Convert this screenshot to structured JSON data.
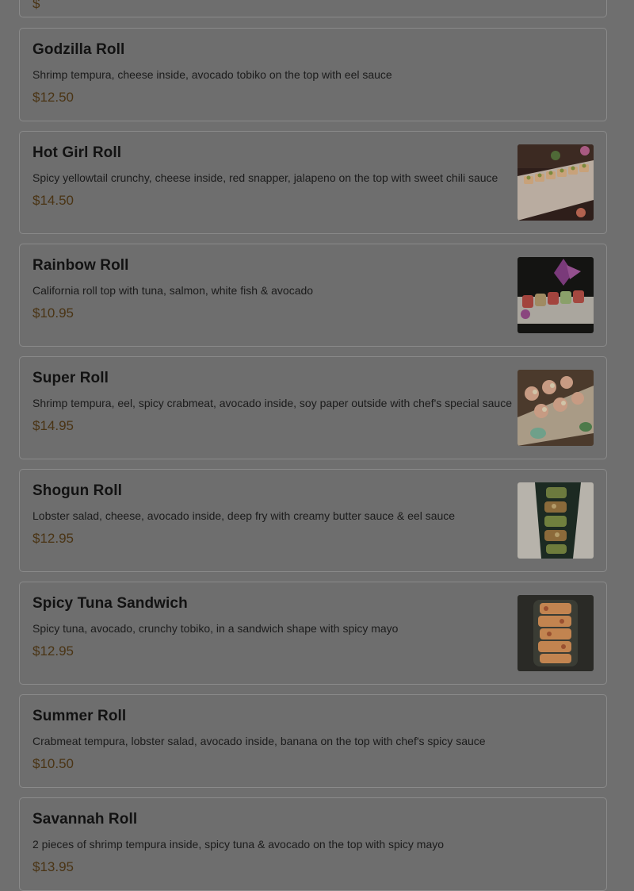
{
  "top_card_price": "$",
  "items": [
    {
      "name": "Godzilla Roll",
      "description": "Shrimp tempura, cheese inside, avocado tobiko on the top with eel sauce",
      "price": "$12.50",
      "image": null
    },
    {
      "name": "Hot Girl Roll",
      "description": "Spicy yellowtail crunchy, cheese inside, red snapper, jalapeno on the top with sweet chili sauce",
      "price": "$14.50",
      "image": "sushi-platter-photo"
    },
    {
      "name": "Rainbow Roll",
      "description": "California roll top with tuna, salmon, white fish & avocado",
      "price": "$10.95",
      "image": "rainbow-roll-photo"
    },
    {
      "name": "Super Roll",
      "description": "Shrimp tempura, eel, spicy crabmeat, avocado inside, soy paper outside with chef's special sauce",
      "price": "$14.95",
      "image": "super-roll-photo"
    },
    {
      "name": "Shogun Roll",
      "description": "Lobster salad, cheese, avocado inside, deep fry with creamy butter sauce & eel sauce",
      "price": "$12.95",
      "image": "shogun-roll-photo"
    },
    {
      "name": "Spicy Tuna Sandwich",
      "description": "Spicy tuna, avocado, crunchy tobiko, in a sandwich shape with spicy mayo",
      "price": "$12.95",
      "image": "spicy-tuna-sandwich-photo"
    },
    {
      "name": "Summer Roll",
      "description": "Crabmeat tempura, lobster salad, avocado inside, banana on the top with chef's spicy sauce",
      "price": "$10.50",
      "image": null
    },
    {
      "name": "Savannah Roll",
      "description": "2 pieces of shrimp tempura inside, spicy tuna & avocado on the top with spicy mayo",
      "price": "$13.95",
      "image": null
    }
  ]
}
